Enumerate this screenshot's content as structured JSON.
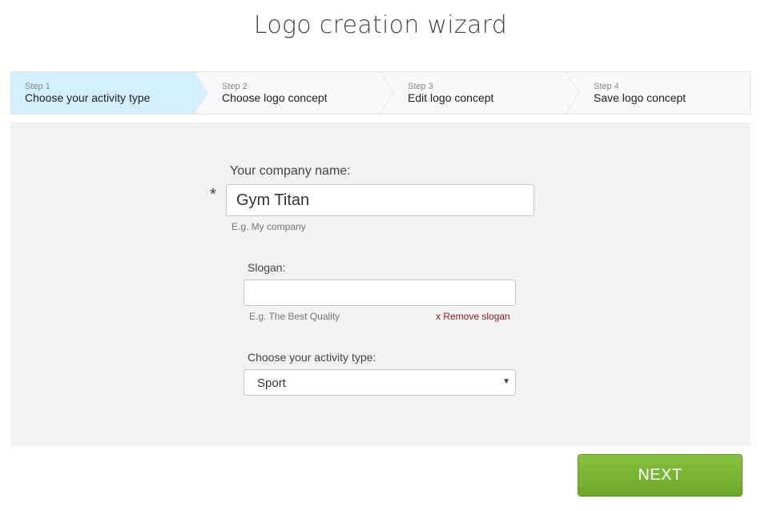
{
  "title": "Logo creation wizard",
  "steps": [
    {
      "number": "Step 1",
      "label": "Choose your activity type",
      "active": true
    },
    {
      "number": "Step 2",
      "label": "Choose logo concept",
      "active": false
    },
    {
      "number": "Step 3",
      "label": "Edit logo concept",
      "active": false
    },
    {
      "number": "Step 4",
      "label": "Save logo concept",
      "active": false
    }
  ],
  "form": {
    "company": {
      "label": "Your company name:",
      "required_mark": "*",
      "value": "Gym Titan",
      "hint": "E.g. My company"
    },
    "slogan": {
      "label": "Slogan:",
      "value": "",
      "hint": "E.g. The Best Quality",
      "remove_label": "x Remove slogan"
    },
    "activity": {
      "label": "Choose your activity type:",
      "selected": "Sport",
      "arrow": "▼"
    }
  },
  "next_button": "NEXT",
  "colors": {
    "active_step": "#d3effd",
    "next_button": "#7ab536",
    "remove_link": "#8b1a1a"
  }
}
